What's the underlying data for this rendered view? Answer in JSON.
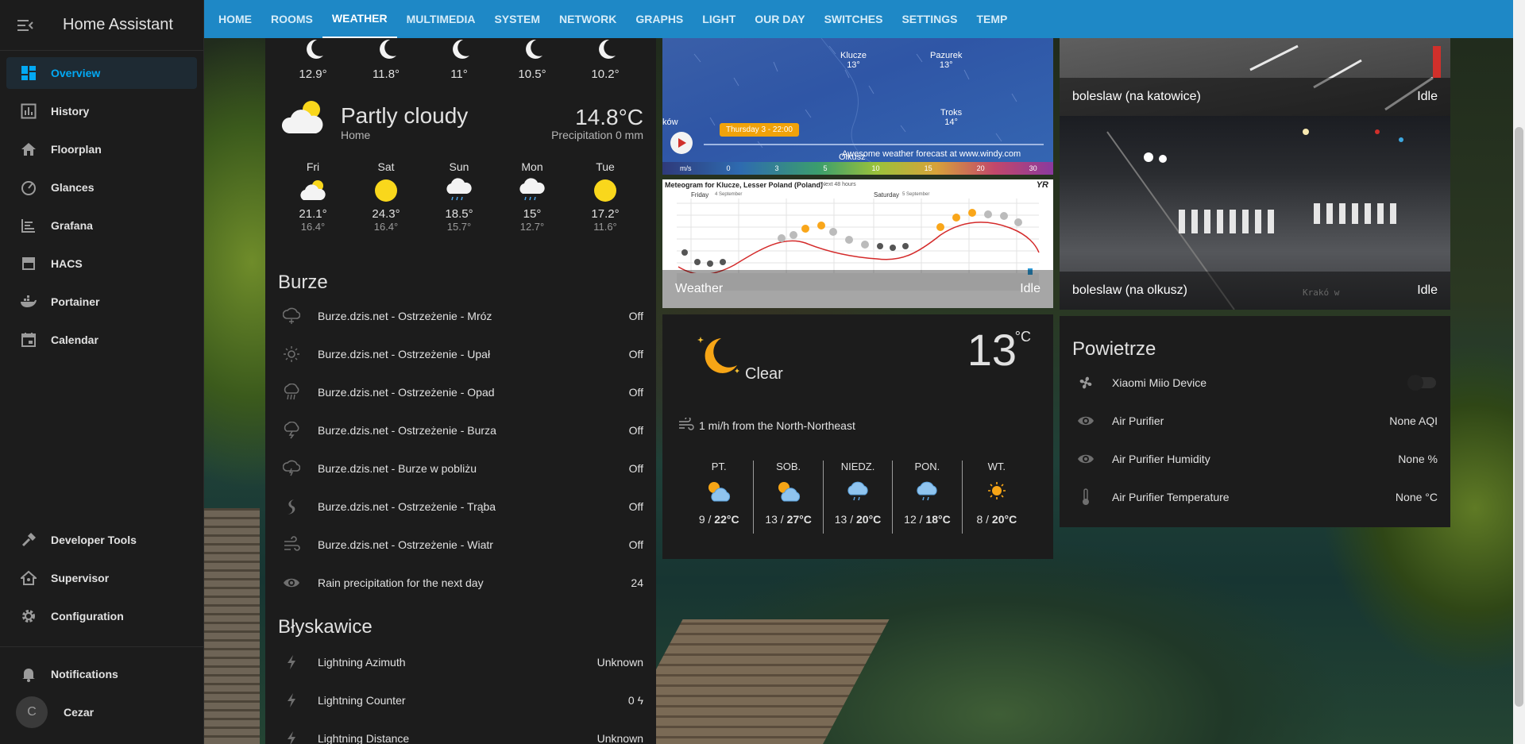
{
  "app": {
    "title": "Home Assistant"
  },
  "sidebar": {
    "items": [
      {
        "label": "Overview",
        "icon": "dashboard-icon"
      },
      {
        "label": "History",
        "icon": "chart-box-icon"
      },
      {
        "label": "Floorplan",
        "icon": "home-icon"
      },
      {
        "label": "Glances",
        "icon": "speedometer-icon"
      },
      {
        "label": "Grafana",
        "icon": "chart-timeline-icon"
      },
      {
        "label": "HACS",
        "icon": "hacs-icon"
      },
      {
        "label": "Portainer",
        "icon": "docker-icon"
      },
      {
        "label": "Calendar",
        "icon": "calendar-icon"
      }
    ],
    "bottom": [
      {
        "label": "Developer Tools",
        "icon": "hammer-icon"
      },
      {
        "label": "Supervisor",
        "icon": "home-assistant-icon"
      },
      {
        "label": "Configuration",
        "icon": "cog-icon"
      },
      {
        "label": "Notifications",
        "icon": "bell-icon"
      }
    ],
    "user": {
      "initial": "C",
      "name": "Cezar"
    }
  },
  "tabs": [
    "HOME",
    "ROOMS",
    "WEATHER",
    "MULTIMEDIA",
    "SYSTEM",
    "NETWORK",
    "GRAPHS",
    "LIGHT",
    "OUR DAY",
    "SWITCHES",
    "SETTINGS",
    "TEMP"
  ],
  "hourly": [
    {
      "temp": "12.9°"
    },
    {
      "temp": "11.8°"
    },
    {
      "temp": "11°"
    },
    {
      "temp": "10.5°"
    },
    {
      "temp": "10.2°"
    }
  ],
  "weather_home": {
    "condition": "Partly cloudy",
    "location": "Home",
    "temp": "14.8°C",
    "precip": "Precipitation 0 mm"
  },
  "daily": [
    {
      "day": "Fri",
      "high": "21.1°",
      "low": "16.4°",
      "icon": "partly-cloudy-icon"
    },
    {
      "day": "Sat",
      "high": "24.3°",
      "low": "16.4°",
      "icon": "sunny-icon"
    },
    {
      "day": "Sun",
      "high": "18.5°",
      "low": "15.7°",
      "icon": "rainy-icon"
    },
    {
      "day": "Mon",
      "high": "15°",
      "low": "12.7°",
      "icon": "rainy-icon"
    },
    {
      "day": "Tue",
      "high": "17.2°",
      "low": "11.6°",
      "icon": "sunny-icon"
    }
  ],
  "burze": {
    "title": "Burze",
    "rows": [
      {
        "name": "Burze.dzis.net - Ostrzeżenie - Mróz",
        "value": "Off",
        "icon": "snow-cloud-icon"
      },
      {
        "name": "Burze.dzis.net - Ostrzeżenie - Upał",
        "value": "Off",
        "icon": "sun-icon"
      },
      {
        "name": "Burze.dzis.net - Ostrzeżenie - Opad",
        "value": "Off",
        "icon": "rain-icon"
      },
      {
        "name": "Burze.dzis.net - Ostrzeżenie - Burza",
        "value": "Off",
        "icon": "storm-icon"
      },
      {
        "name": "Burze.dzis.net - Burze w pobliżu",
        "value": "Off",
        "icon": "storm-cloud-icon"
      },
      {
        "name": "Burze.dzis.net - Ostrzeżenie - Trąba",
        "value": "Off",
        "icon": "tornado-icon"
      },
      {
        "name": "Burze.dzis.net - Ostrzeżenie - Wiatr",
        "value": "Off",
        "icon": "wind-icon"
      },
      {
        "name": "Rain precipitation for the next day",
        "value": "24",
        "icon": "eye-icon"
      }
    ]
  },
  "lightning": {
    "title": "Błyskawice",
    "rows": [
      {
        "name": "Lightning Azimuth",
        "value": "Unknown"
      },
      {
        "name": "Lightning Counter",
        "value": "0 ϟ"
      },
      {
        "name": "Lightning Distance",
        "value": "Unknown"
      }
    ]
  },
  "windy": {
    "cities": [
      {
        "name": "Klucze",
        "temp": "13°"
      },
      {
        "name": "Pazurek",
        "temp": "13°"
      },
      {
        "name": "Troks",
        "temp": "14°"
      }
    ],
    "side": "ków",
    "olkusz": "Olkusz",
    "time_badge": "Thursday 3 - 22:00",
    "credit": "Awesome weather forecast at www.windy.com",
    "unit": "m/s",
    "scale": [
      "0",
      "3",
      "5",
      "10",
      "15",
      "20",
      "30"
    ]
  },
  "meteogram": {
    "title": "Meteogram for Klucze, Lesser Poland (Poland)",
    "next": "Next 48 hours",
    "logo": "YR",
    "day1": "Friday",
    "day1_date": "4 September",
    "day2": "Saturday",
    "day2_date": "5 September",
    "caption": "Weather",
    "state": "Idle"
  },
  "clear": {
    "condition": "Clear",
    "temp": "13",
    "unit": "°C",
    "wind": "1 mi/h from the North-Northeast",
    "days": [
      {
        "day": "PT.",
        "lo": "9",
        "hi": "22°C",
        "icon": "partly-sunny-icon"
      },
      {
        "day": "SOB.",
        "lo": "13",
        "hi": "27°C",
        "icon": "partly-sunny-icon"
      },
      {
        "day": "NIEDZ.",
        "lo": "13",
        "hi": "20°C",
        "icon": "rain-cloud-icon"
      },
      {
        "day": "PON.",
        "lo": "12",
        "hi": "18°C",
        "icon": "rain-cloud-icon"
      },
      {
        "day": "WT.",
        "lo": "8",
        "hi": "20°C",
        "icon": "sun-icon"
      }
    ]
  },
  "cams": [
    {
      "name": "boleslaw (na katowice)",
      "state": "Idle"
    },
    {
      "name": "boleslaw (na olkusz)",
      "state": "Idle",
      "watermark": "Krakó w"
    }
  ],
  "air": {
    "title": "Powietrze",
    "rows": [
      {
        "name": "Xiaomi Miio Device",
        "value": "",
        "icon": "fan-icon"
      },
      {
        "name": "Air Purifier",
        "value": "None AQI",
        "icon": "eye-icon"
      },
      {
        "name": "Air Purifier Humidity",
        "value": "None %",
        "icon": "eye-icon"
      },
      {
        "name": "Air Purifier Temperature",
        "value": "None °C",
        "icon": "thermometer-icon"
      }
    ]
  }
}
